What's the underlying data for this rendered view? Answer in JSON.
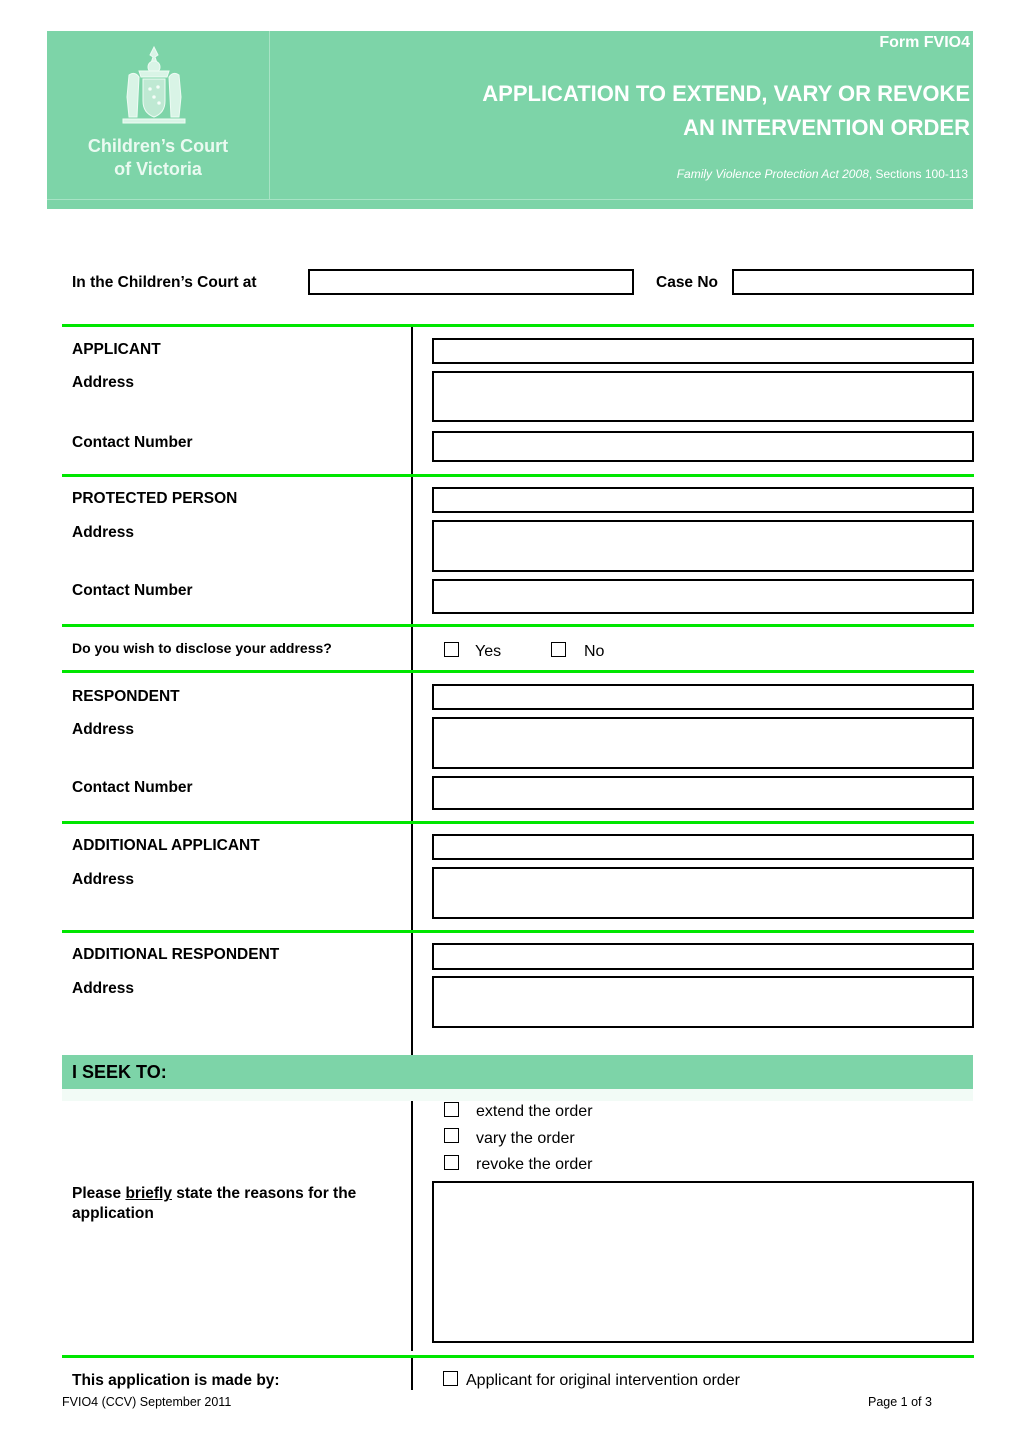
{
  "header": {
    "court_name_line1": "Children’s Court",
    "court_name_line2": "of Victoria",
    "form_id": "Form FVIO4",
    "title_line1": "APPLICATION TO EXTEND, VARY OR REVOKE",
    "title_line2": "AN INTERVENTION ORDER",
    "act_name": "Family Violence Protection Act 2008",
    "act_sections": ", Sections 100-113",
    "brand_color": "#7dd4a8",
    "crest_icon": "coat-of-arms-icon"
  },
  "court_row": {
    "court_label": "In the Children’s Court at",
    "court_value": "",
    "case_label": "Case No",
    "case_value": ""
  },
  "sections": {
    "applicant": {
      "heading": "APPLICANT",
      "address_label": "Address",
      "contact_label": "Contact Number",
      "name_value": "",
      "address_value": "",
      "contact_value": ""
    },
    "protected_person": {
      "heading": "PROTECTED PERSON",
      "address_label": "Address",
      "contact_label": "Contact Number",
      "name_value": "",
      "address_value": "",
      "contact_value": ""
    },
    "disclose": {
      "question": "Do you wish to disclose your address?",
      "yes_label": "Yes",
      "no_label": "No",
      "yes_checked": false,
      "no_checked": false
    },
    "respondent": {
      "heading": "RESPONDENT",
      "address_label": "Address",
      "contact_label": "Contact Number",
      "name_value": "",
      "address_value": "",
      "contact_value": ""
    },
    "additional_applicant": {
      "heading": "ADDITIONAL APPLICANT",
      "address_label": "Address",
      "name_value": "",
      "address_value": ""
    },
    "additional_respondent": {
      "heading": "ADDITIONAL RESPONDENT",
      "address_label": "Address",
      "name_value": "",
      "address_value": ""
    }
  },
  "seek": {
    "heading": "I SEEK TO:",
    "options": [
      {
        "label": "extend the order",
        "checked": false
      },
      {
        "label": "vary the order",
        "checked": false
      },
      {
        "label": "revoke the order",
        "checked": false
      }
    ],
    "reasons_label_pre": "Please ",
    "reasons_label_emph": "briefly",
    "reasons_label_post": " state the reasons for the",
    "reasons_label_line2": "application",
    "reasons_value": ""
  },
  "made_by": {
    "label": "This application is made by:",
    "option": "Applicant for original intervention order",
    "checked": false
  },
  "footer": {
    "left": "FVIO4 (CCV) September 2011",
    "right": "Page 1 of 3"
  },
  "colors": {
    "rule_green": "#00e600",
    "header_green": "#7dd4a8"
  }
}
